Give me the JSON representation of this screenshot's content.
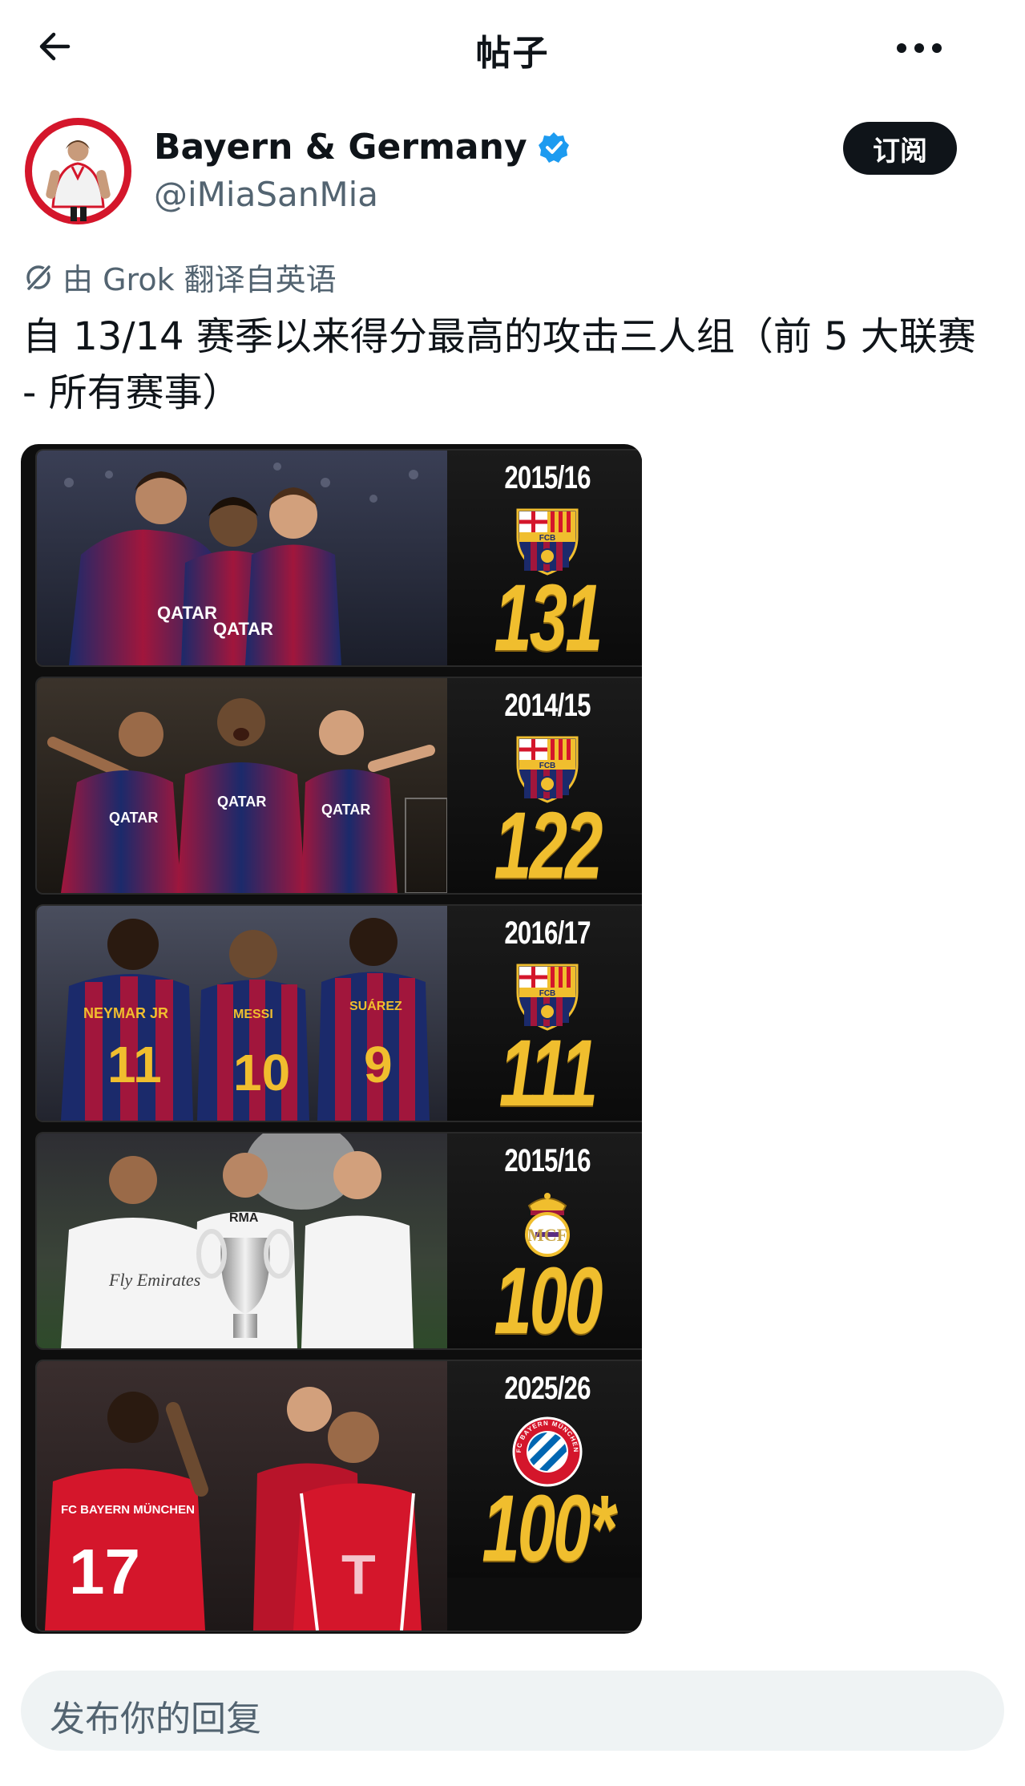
{
  "header": {
    "title": "帖子",
    "back_icon": "arrow-left-icon",
    "more_icon": "more-horizontal-icon"
  },
  "author": {
    "display_name": "Bayern & Germany",
    "handle": "@iMiaSanMia",
    "verified": true,
    "avatar_text": "iMiaSanMia",
    "subscribe_label": "订阅"
  },
  "translation": {
    "note": "由 Grok 翻译自英语"
  },
  "post": {
    "text": "自 13/14 赛季以来得分最高的攻击三人组（前 5 大联赛 - 所有赛事）"
  },
  "media": {
    "panels": [
      {
        "season": "2015/16",
        "club": "barcelona",
        "goals": "131",
        "crest_text": "FCB",
        "shirt_text": [
          "QATAR",
          "QATAR"
        ],
        "colors": {
          "primary": "#1b2a6b",
          "secondary": "#a1163c",
          "background": "#2a2f45"
        }
      },
      {
        "season": "2014/15",
        "club": "barcelona",
        "goals": "122",
        "crest_text": "FCB",
        "shirt_text": [
          "QATAR",
          "QATAR",
          "QATAR"
        ],
        "colors": {
          "primary": "#1b2a6b",
          "secondary": "#a1163c",
          "background": "#2c2520"
        }
      },
      {
        "season": "2016/17",
        "club": "barcelona",
        "goals": "111",
        "crest_text": "FCB",
        "shirt_text": [
          "NEYMAR JR",
          "11",
          "MESSI",
          "10",
          "SUÁREZ",
          "9"
        ],
        "colors": {
          "primary": "#1b2a6b",
          "secondary": "#a1163c",
          "background": "#3a3d4a"
        }
      },
      {
        "season": "2015/16",
        "club": "real-madrid",
        "goals": "100",
        "crest_text": "",
        "shirt_text": [
          "Fly Emirates",
          "RMA"
        ],
        "colors": {
          "primary": "#f4f4f4",
          "secondary": "#c9a646",
          "background": "#3b4a3a"
        }
      },
      {
        "season": "2025/26",
        "club": "bayern",
        "goals": "100*",
        "crest_text": "FC BAYERN MÜNCHEN",
        "shirt_text": [
          "FC BAYERN MÜNCHEN",
          "17",
          "T"
        ],
        "colors": {
          "primary": "#d4162b",
          "secondary": "#ffffff",
          "background": "#2a2222"
        }
      }
    ]
  },
  "reply": {
    "placeholder": "发布你的回复"
  },
  "colors": {
    "text": "#0f1419",
    "secondary_text": "#536471",
    "verified": "#1d9bf0",
    "gold": "#f0be2e",
    "reply_bg": "#eff3f4"
  }
}
